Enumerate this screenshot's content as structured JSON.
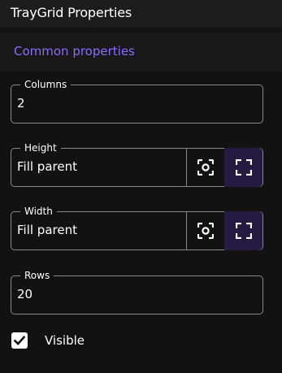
{
  "header": {
    "title": "TrayGrid Properties"
  },
  "section": {
    "label": "Common properties"
  },
  "fields": {
    "columns": {
      "label": "Columns",
      "value": "2"
    },
    "height": {
      "label": "Height",
      "value": "Fill parent",
      "buttons": [
        "fit-content-icon",
        "fill-parent-icon"
      ]
    },
    "width": {
      "label": "Width",
      "value": "Fill parent",
      "buttons": [
        "fit-content-icon",
        "fill-parent-icon"
      ]
    },
    "rows": {
      "label": "Rows",
      "value": "20"
    }
  },
  "visible": {
    "label": "Visible",
    "checked": true
  },
  "colors": {
    "accent": "#8a6cff",
    "background": "#121212",
    "selected_button": "#241b40",
    "border": "#8a8a8a"
  }
}
